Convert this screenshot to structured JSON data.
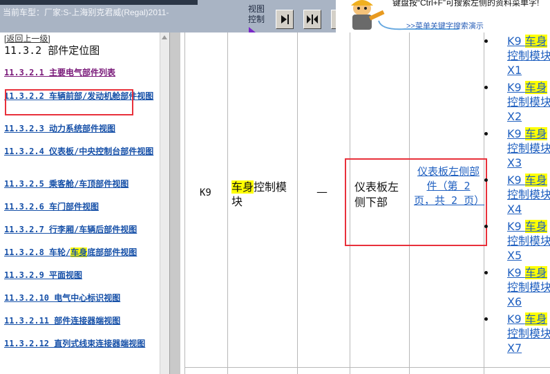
{
  "topbar": {
    "car_info": "当前车型：厂家:S-上海别克君威(Regal)2011-",
    "view_label_1": "视图",
    "view_label_2": "控制"
  },
  "help_popup": {
    "text": "键盘按“Ctrl+F”可搜索左侧的资料菜单字!",
    "link": ">>菜单关键字搜索演示"
  },
  "nav": {
    "back_link": "[返回上一级]",
    "section_title": "11.3.2 部件定位图",
    "items": [
      {
        "label": "11.3.2.1 主要电气部件列表"
      },
      {
        "label": "11.3.2.2 车辆前部/发动机舱部件视图"
      },
      {
        "label": "11.3.2.3 动力系统部件视图"
      },
      {
        "label": "11.3.2.4 仪表板/中央控制台部件视图"
      },
      {
        "label": "11.3.2.5 乘客舱/车顶部件视图"
      },
      {
        "label": "11.3.2.6 车门部件视图"
      },
      {
        "label": "11.3.2.7 行李厢/车辆后部件视图"
      },
      {
        "label_pre": "11.3.2.8 车轮/",
        "label_hl": "车身",
        "label_post": "底部部件视图"
      },
      {
        "label": "11.3.2.9 平面视图"
      },
      {
        "label": "11.3.2.10 电气中心标识视图"
      },
      {
        "label": "11.3.2.11 部件连接器端视图"
      },
      {
        "label": "11.3.2.12 直列式线束连接器端视图"
      }
    ]
  },
  "row": {
    "code": "K9",
    "name_hl": "车身",
    "name_rest": "控制模块",
    "dash": "—",
    "location": "仪表板左侧下部",
    "view_link": "仪表板左侧部件（第 2 页，共 2 页）"
  },
  "connectors": [
    {
      "pre": "K9 ",
      "hl": "车身",
      "l2": "控制模块",
      "l3": "X1"
    },
    {
      "pre": "K9 ",
      "hl": "车身",
      "l2": "控制模块",
      "l3": "X2"
    },
    {
      "pre": "K9 ",
      "hl": "车身",
      "l2": "控制模块",
      "l3": "X3"
    },
    {
      "pre": "K9 ",
      "hl": "车身",
      "l2": "控制模块",
      "l3": "X4"
    },
    {
      "pre": "K9 ",
      "hl": "车身",
      "l2": "控制模块",
      "l3": "X5"
    },
    {
      "pre": "K9 ",
      "hl": "车身",
      "l2": "控制模块",
      "l3": "X6"
    },
    {
      "pre": "K9 ",
      "hl": "车身",
      "l2": "控制模块",
      "l3": "X7"
    }
  ],
  "colors": {
    "highlight": "#ffff00",
    "annotation_box": "#e8303a",
    "link": "#2060c0",
    "visited_link": "#7a1a7a"
  }
}
